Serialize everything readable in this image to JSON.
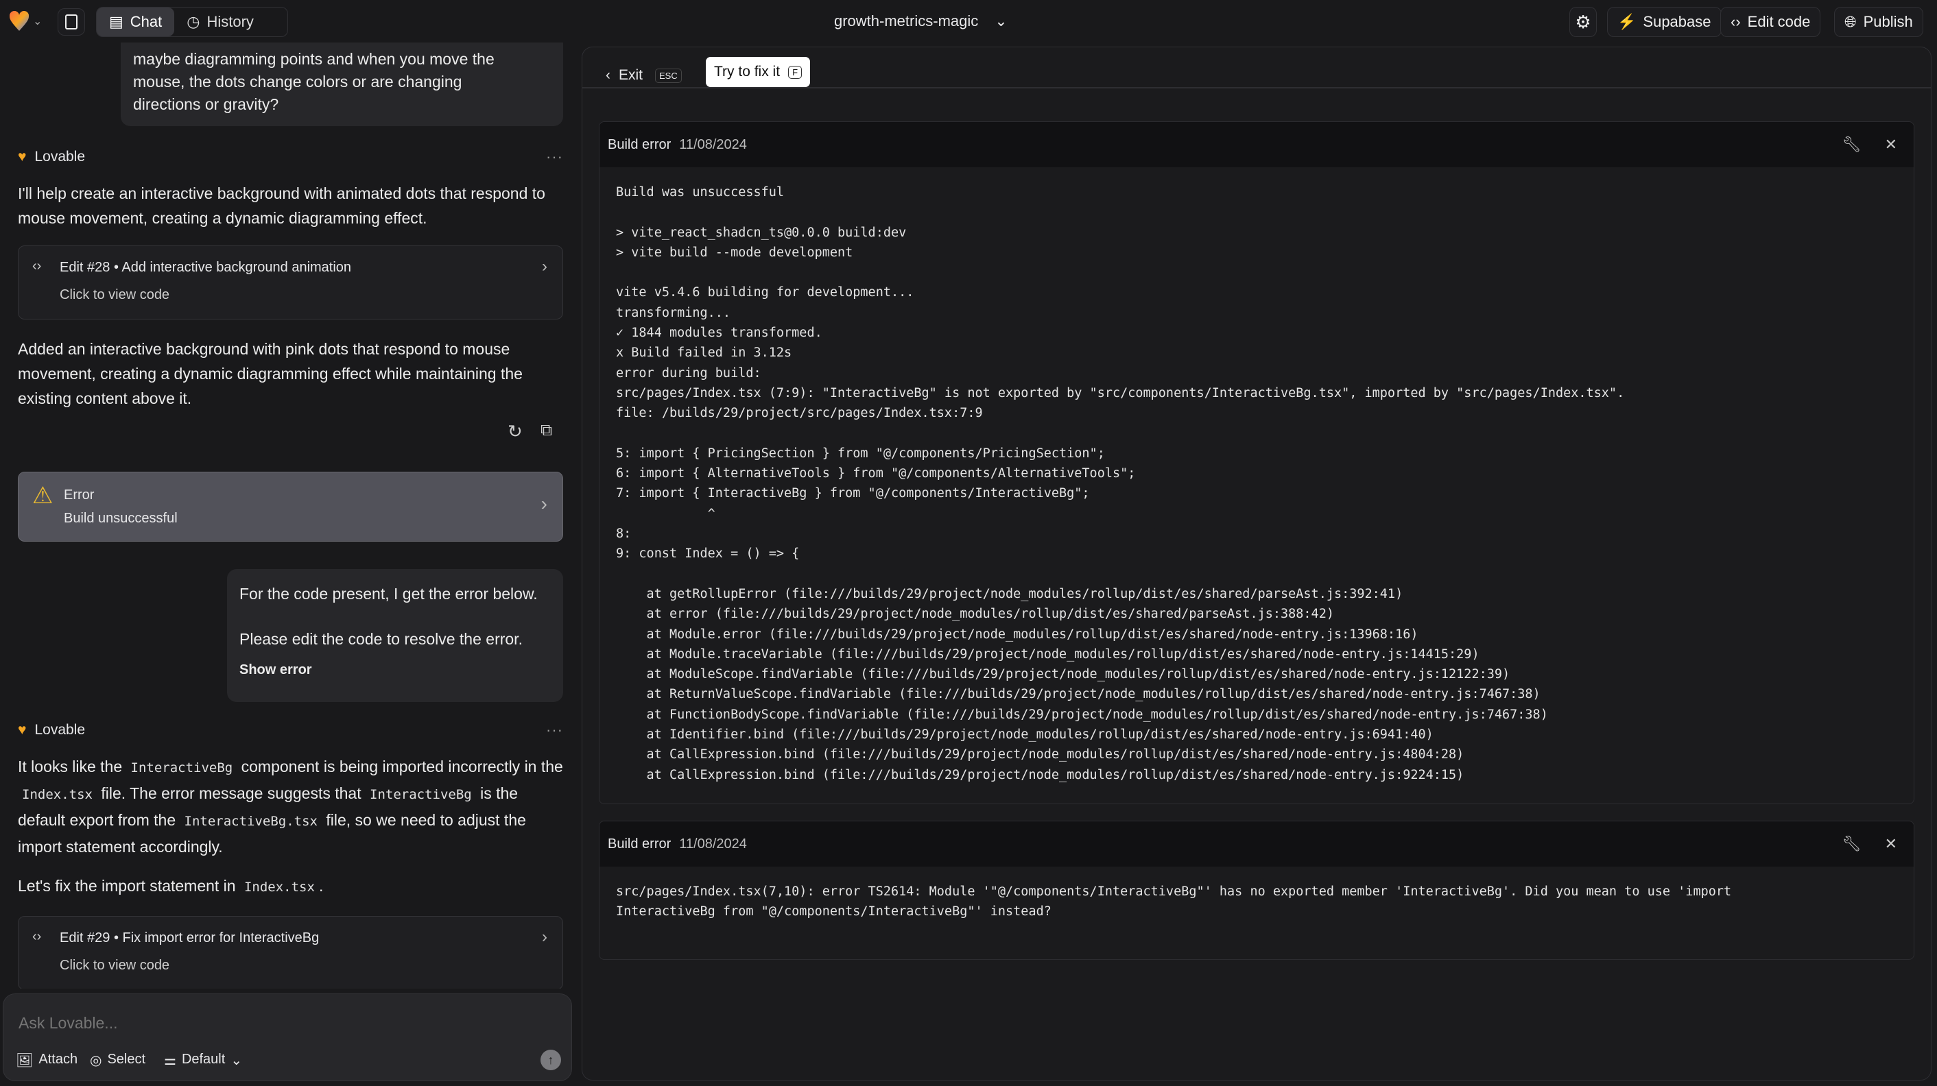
{
  "topbar": {
    "tabs": [
      {
        "label": "Chat",
        "active": true
      },
      {
        "label": "History",
        "active": false
      }
    ],
    "project": "growth-metrics-magic",
    "buttons": {
      "supabase": "Supabase",
      "edit_code": "Edit code",
      "publish": "Publish"
    },
    "colors": {
      "supabase": "#3ecf8e"
    }
  },
  "chat": {
    "user1": [
      "maybe diagramming points and when you move the",
      "mouse, the dots change colors or are changing",
      "directions or gravity?"
    ],
    "author": "Lovable",
    "reply1": "I'll help create an interactive background with animated dots that respond to mouse movement, creating a dynamic diagramming effect.",
    "edit28": {
      "title": "Edit #28 • Add interactive background animation",
      "sub": "Click to view code"
    },
    "reply1b": "Added an interactive background with pink dots that respond to mouse movement, creating a dynamic diagramming effect while maintaining the existing content above it.",
    "error": {
      "title": "Error",
      "sub": "Build unsuccessful",
      "color": "#e8b931"
    },
    "user2": {
      "line1": "For the code present, I get the error below.",
      "line2": "Please edit the code to resolve the error.",
      "show": "Show error"
    },
    "reply2": {
      "a": "It looks like the",
      "c1": "InteractiveBg",
      "b": "component is being imported incorrectly in the",
      "c2": "Index.tsx",
      "d": "file. The error message suggests that",
      "c3": "InteractiveBg",
      "e": "is the default export from the",
      "c4": "InteractiveBg.tsx",
      "f": "file, so we need to adjust the import statement accordingly.",
      "g": "Let's fix the import statement in",
      "c5": "Index.tsx",
      "h": "."
    },
    "edit29": {
      "title": "Edit #29 • Fix import error for InteractiveBg",
      "sub": "Click to view code"
    },
    "input": {
      "placeholder": "Ask Lovable...",
      "attach": "Attach",
      "select": "Select",
      "mode": "Default"
    }
  },
  "panel": {
    "exit": "Exit",
    "esc": "ESC",
    "fix": "Try to fix it",
    "fix_key": "F",
    "errors": [
      {
        "title": "Build error",
        "date": "11/08/2024",
        "lines": [
          "Build was unsuccessful",
          "",
          "> vite_react_shadcn_ts@0.0.0 build:dev",
          "> vite build --mode development",
          "",
          "vite v5.4.6 building for development...",
          "transforming...",
          "✓ 1844 modules transformed.",
          "x Build failed in 3.12s",
          "error during build:",
          "src/pages/Index.tsx (7:9): \"InteractiveBg\" is not exported by \"src/components/InteractiveBg.tsx\", imported by \"src/pages/Index.tsx\".",
          "file: /builds/29/project/src/pages/Index.tsx:7:9",
          "",
          "5: import { PricingSection } from \"@/components/PricingSection\";",
          "6: import { AlternativeTools } from \"@/components/AlternativeTools\";",
          "7: import { InteractiveBg } from \"@/components/InteractiveBg\";",
          "            ^",
          "8:",
          "9: const Index = () => {",
          "",
          "    at getRollupError (file:///builds/29/project/node_modules/rollup/dist/es/shared/parseAst.js:392:41)",
          "    at error (file:///builds/29/project/node_modules/rollup/dist/es/shared/parseAst.js:388:42)",
          "    at Module.error (file:///builds/29/project/node_modules/rollup/dist/es/shared/node-entry.js:13968:16)",
          "    at Module.traceVariable (file:///builds/29/project/node_modules/rollup/dist/es/shared/node-entry.js:14415:29)",
          "    at ModuleScope.findVariable (file:///builds/29/project/node_modules/rollup/dist/es/shared/node-entry.js:12122:39)",
          "    at ReturnValueScope.findVariable (file:///builds/29/project/node_modules/rollup/dist/es/shared/node-entry.js:7467:38)",
          "    at FunctionBodyScope.findVariable (file:///builds/29/project/node_modules/rollup/dist/es/shared/node-entry.js:7467:38)",
          "    at Identifier.bind (file:///builds/29/project/node_modules/rollup/dist/es/shared/node-entry.js:6941:40)",
          "    at CallExpression.bind (file:///builds/29/project/node_modules/rollup/dist/es/shared/node-entry.js:4804:28)",
          "    at CallExpression.bind (file:///builds/29/project/node_modules/rollup/dist/es/shared/node-entry.js:9224:15)"
        ]
      },
      {
        "title": "Build error",
        "date": "11/08/2024",
        "lines": [
          "src/pages/Index.tsx(7,10): error TS2614: Module '\"@/components/InteractiveBg\"' has no exported member 'InteractiveBg'. Did you mean to use 'import",
          "InteractiveBg from \"@/components/InteractiveBg\"' instead?"
        ]
      }
    ]
  }
}
